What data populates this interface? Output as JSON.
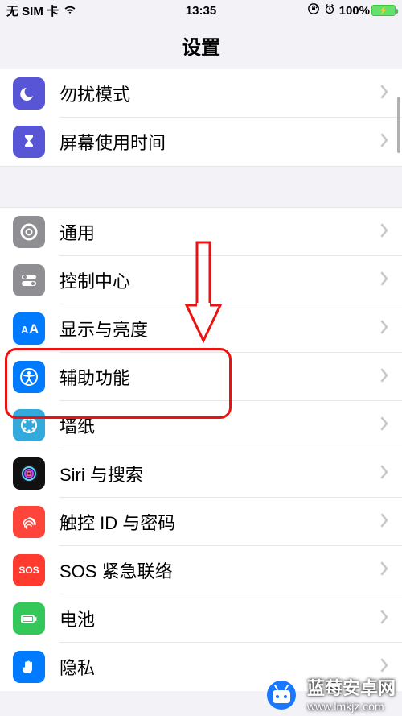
{
  "statusbar": {
    "carrier": "无 SIM 卡",
    "time": "13:35",
    "battery_pct": "100%"
  },
  "navbar": {
    "title": "设置"
  },
  "group1": [
    {
      "label": "勿扰模式",
      "icon": "moon-icon",
      "bg": "ic-purple"
    },
    {
      "label": "屏幕使用时间",
      "icon": "hourglass-icon",
      "bg": "ic-indigo"
    }
  ],
  "group2": [
    {
      "label": "通用",
      "icon": "gear-icon",
      "bg": "ic-gray"
    },
    {
      "label": "控制中心",
      "icon": "switches-icon",
      "bg": "ic-gray"
    },
    {
      "label": "显示与亮度",
      "icon": "textsize-icon",
      "bg": "ic-blue"
    },
    {
      "label": "辅助功能",
      "icon": "accessibility-icon",
      "bg": "ic-blue"
    },
    {
      "label": "墙纸",
      "icon": "wallpaper-icon",
      "bg": "ic-teal"
    },
    {
      "label": "Siri 与搜索",
      "icon": "siri-icon",
      "bg": "ic-siri"
    },
    {
      "label": "触控 ID 与密码",
      "icon": "fingerprint-icon",
      "bg": "ic-finger"
    },
    {
      "label": "SOS 紧急联络",
      "icon": "sos-icon",
      "bg": "ic-sos"
    },
    {
      "label": "电池",
      "icon": "battery-icon",
      "bg": "ic-green"
    },
    {
      "label": "隐私",
      "icon": "hand-icon",
      "bg": "ic-privacy"
    }
  ],
  "watermark": {
    "line1": "蓝莓安卓网",
    "line2": "www.lmkjz.com"
  },
  "colors": {
    "highlight": "#e11",
    "chevron": "#c7c7cc",
    "battery": "#3bc93b"
  }
}
